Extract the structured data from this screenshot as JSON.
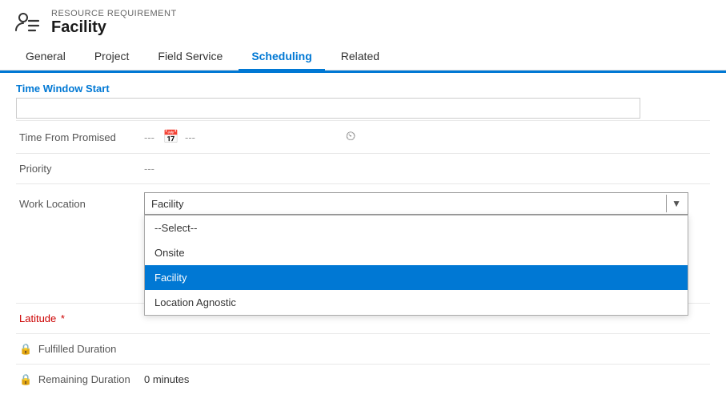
{
  "header": {
    "subtitle": "RESOURCE REQUIREMENT",
    "title": "Facility"
  },
  "tabs": [
    {
      "id": "general",
      "label": "General",
      "active": false
    },
    {
      "id": "project",
      "label": "Project",
      "active": false
    },
    {
      "id": "field-service",
      "label": "Field Service",
      "active": false
    },
    {
      "id": "scheduling",
      "label": "Scheduling",
      "active": true
    },
    {
      "id": "related",
      "label": "Related",
      "active": false
    }
  ],
  "form": {
    "section_label": "Time Window Start",
    "time_window_start_value": "",
    "fields": {
      "time_from_promised_label": "Time From Promised",
      "time_from_promised_value1": "---",
      "time_from_promised_value2": "---",
      "priority_label": "Priority",
      "priority_value": "---",
      "work_location_label": "Work Location",
      "work_location_value": "Facility",
      "latitude_label": "Latitude",
      "fulfilled_duration_label": "Fulfilled Duration",
      "remaining_duration_label": "Remaining Duration",
      "remaining_duration_value": "0 minutes"
    },
    "dropdown": {
      "options": [
        {
          "id": "select",
          "label": "--Select--",
          "selected": false
        },
        {
          "id": "onsite",
          "label": "Onsite",
          "selected": false
        },
        {
          "id": "facility",
          "label": "Facility",
          "selected": true
        },
        {
          "id": "location-agnostic",
          "label": "Location Agnostic",
          "selected": false
        }
      ]
    }
  }
}
